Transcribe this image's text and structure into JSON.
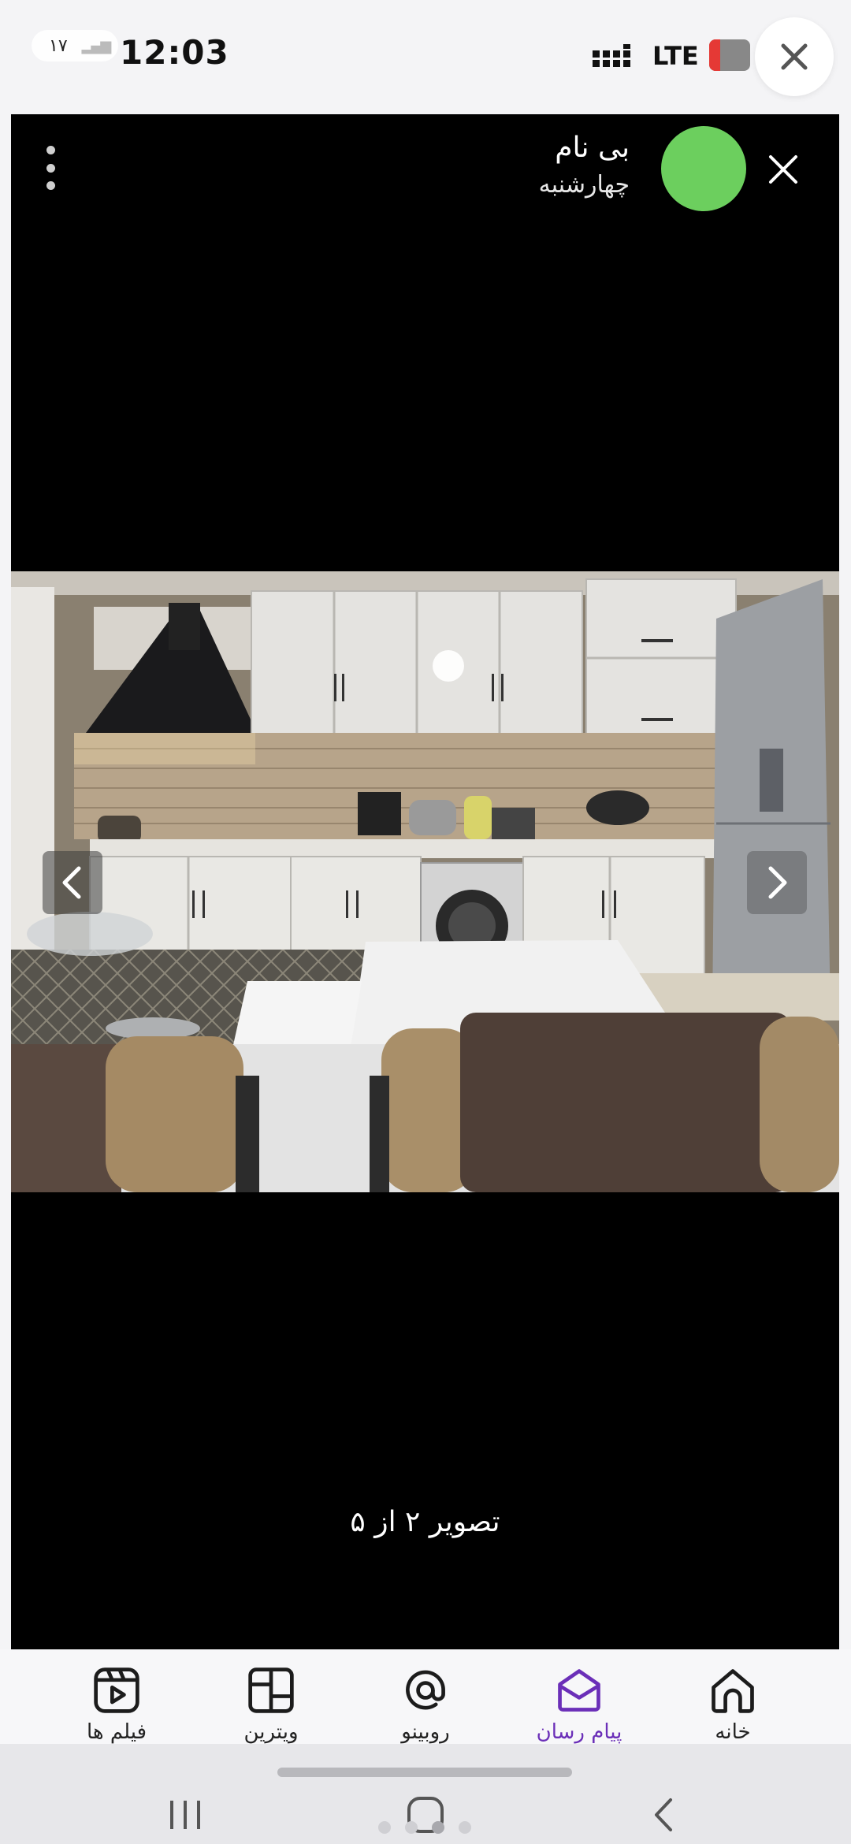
{
  "status_bar": {
    "notification_count": "۱۷",
    "time": "12:03",
    "network": "LTE",
    "battery_level": "low"
  },
  "viewer": {
    "sender_name": "بی نام",
    "sender_date": "چهارشنبه",
    "avatar_color": "#6ccf5e",
    "image_counter": "تصویر ۲ از ۵",
    "current_image": 2,
    "total_images": 5
  },
  "bottom_nav": {
    "accent_color": "#6b2fb8",
    "items": [
      {
        "label": "فیلم ها",
        "icon": "video-icon",
        "active": false
      },
      {
        "label": "ویترین",
        "icon": "showcase-grid-icon",
        "active": false
      },
      {
        "label": "روبینو",
        "icon": "at-sign-icon",
        "active": false
      },
      {
        "label": "پیام رسان",
        "icon": "messenger-envelope-icon",
        "active": true
      },
      {
        "label": "خانه",
        "icon": "home-icon",
        "active": false
      }
    ]
  },
  "system_nav": {
    "icons": [
      "recents-icon",
      "home-square-icon",
      "back-chevron-icon"
    ],
    "page_indicator_count": 4,
    "page_indicator_active": 3
  }
}
